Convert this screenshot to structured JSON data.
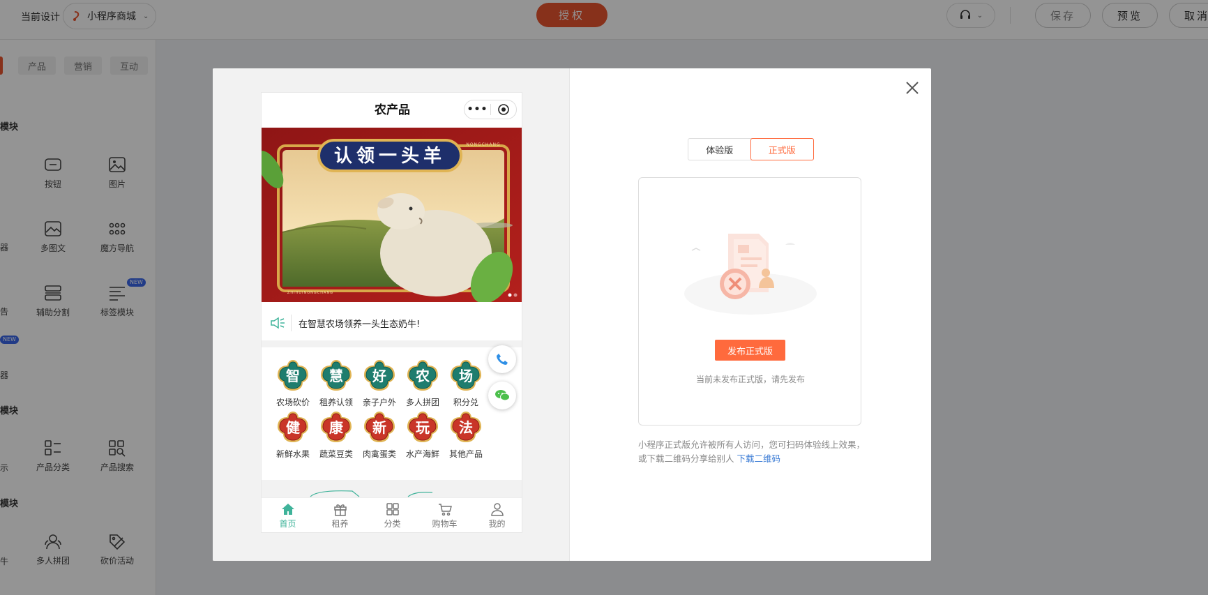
{
  "topbar": {
    "current_design_label": "当前设计",
    "design_name": "小程序商城",
    "auth_label": "授权",
    "save_label": "保存",
    "preview_label": "预览",
    "cancel_label": "取消"
  },
  "sidebar": {
    "tabs": [
      "产品",
      "营销",
      "互动"
    ],
    "sections": [
      {
        "heading": "模块"
      },
      {
        "heading": "模块"
      },
      {
        "heading": "模块"
      }
    ],
    "items": [
      {
        "label": "按钮",
        "icon": "button-icon"
      },
      {
        "label": "图片",
        "icon": "image-icon"
      },
      {
        "label": "多图文",
        "icon": "multi-image-text-icon"
      },
      {
        "label": "魔方导航",
        "icon": "grid-nav-icon"
      },
      {
        "label": "辅助分割",
        "icon": "divider-icon"
      },
      {
        "label": "标签模块",
        "icon": "tag-list-icon",
        "badge": "NEW"
      },
      {
        "label": "产品分类",
        "icon": "category-icon"
      },
      {
        "label": "产品搜索",
        "icon": "product-search-icon"
      },
      {
        "label": "多人拼团",
        "icon": "group-buy-icon"
      },
      {
        "label": "砍价活动",
        "icon": "bargain-icon"
      }
    ],
    "cut_labels": [
      "器",
      "告",
      "器",
      "示",
      "牛"
    ],
    "cut_badge": "NEW"
  },
  "phone": {
    "title": "农产品",
    "capsule_dots": "•••",
    "banner": {
      "headline": "认领一头羊",
      "brand_top": "NONGCHANG",
      "brand_bottom": "ZHIHUINONGCHANG"
    },
    "notice": "在智慧农场领养一头生态奶牛!",
    "categories": [
      {
        "char": "智",
        "label": "农场砍价",
        "color": "teal"
      },
      {
        "char": "慧",
        "label": "租养认领",
        "color": "teal"
      },
      {
        "char": "好",
        "label": "亲子户外",
        "color": "teal"
      },
      {
        "char": "农",
        "label": "多人拼团",
        "color": "teal"
      },
      {
        "char": "场",
        "label": "积分兑",
        "color": "teal"
      },
      {
        "char": "健",
        "label": "新鲜水果",
        "color": "red"
      },
      {
        "char": "康",
        "label": "蔬菜豆类",
        "color": "red"
      },
      {
        "char": "新",
        "label": "肉禽蛋类",
        "color": "red"
      },
      {
        "char": "玩",
        "label": "水产海鲜",
        "color": "red"
      },
      {
        "char": "法",
        "label": "其他产品",
        "color": "red"
      }
    ],
    "tabs": [
      {
        "label": "首页",
        "icon": "home-icon",
        "active": true
      },
      {
        "label": "租养",
        "icon": "gift-icon",
        "active": false
      },
      {
        "label": "分类",
        "icon": "category-grid-icon",
        "active": false
      },
      {
        "label": "购物车",
        "icon": "cart-icon",
        "active": false
      },
      {
        "label": "我的",
        "icon": "user-icon",
        "active": false
      }
    ]
  },
  "publish_panel": {
    "versions": [
      "体验版",
      "正式版"
    ],
    "active_version": "正式版",
    "publish_button": "发布正式版",
    "status_text": "当前未发布正式版，请先发布",
    "description": "小程序正式版允许被所有人访问，您可扫码体验线上效果，或下载二维码分享给别人",
    "download_link": "下载二维码"
  },
  "colors": {
    "accent": "#e8552f",
    "publish_orange": "#ff6a3d",
    "teal": "#3fb39a",
    "link": "#3a7bd5"
  }
}
